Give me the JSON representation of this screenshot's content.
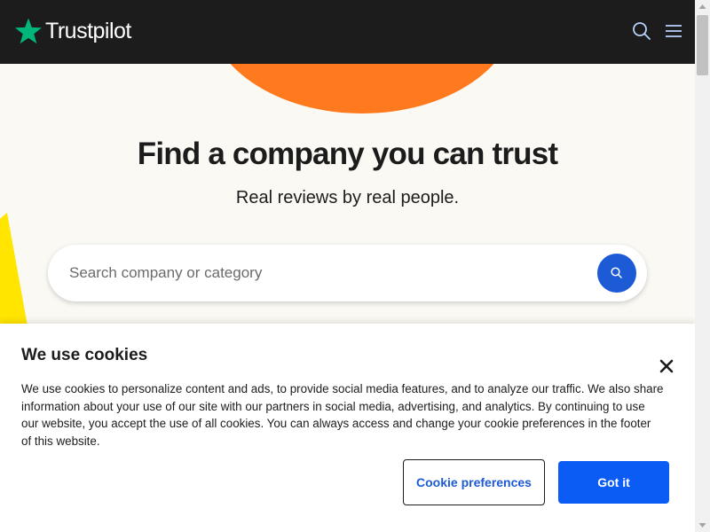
{
  "header": {
    "logo_text": "Trustpilot",
    "logo_icon": "star-icon",
    "search_icon": "search-icon",
    "menu_icon": "hamburger-menu-icon",
    "brand_color": "#00b67a",
    "background": "#1c1c1c"
  },
  "hero": {
    "title": "Find a company you can trust",
    "subtitle": "Real reviews by real people."
  },
  "search": {
    "placeholder": "Search company or category",
    "value": "",
    "button_icon": "search-icon",
    "button_color": "#1c5ad6"
  },
  "cookie_banner": {
    "title": "We use cookies",
    "text": "We use cookies to personalize content and ads, to provide social media features, and to analyze our traffic. We also share information about your use of our site with our partners in social media, advertising, and analytics. By continuing to use our website, you accept the use of all cookies. You can always access and change your cookie preferences in the footer of this website.",
    "preferences_label": "Cookie preferences",
    "accept_label": "Got it",
    "close_icon": "close-icon",
    "accept_color": "#0a5cf5"
  },
  "decor": {
    "orange": "#ff7a1e",
    "yellow": "#ffe500",
    "page_background": "#fbf9f3"
  }
}
